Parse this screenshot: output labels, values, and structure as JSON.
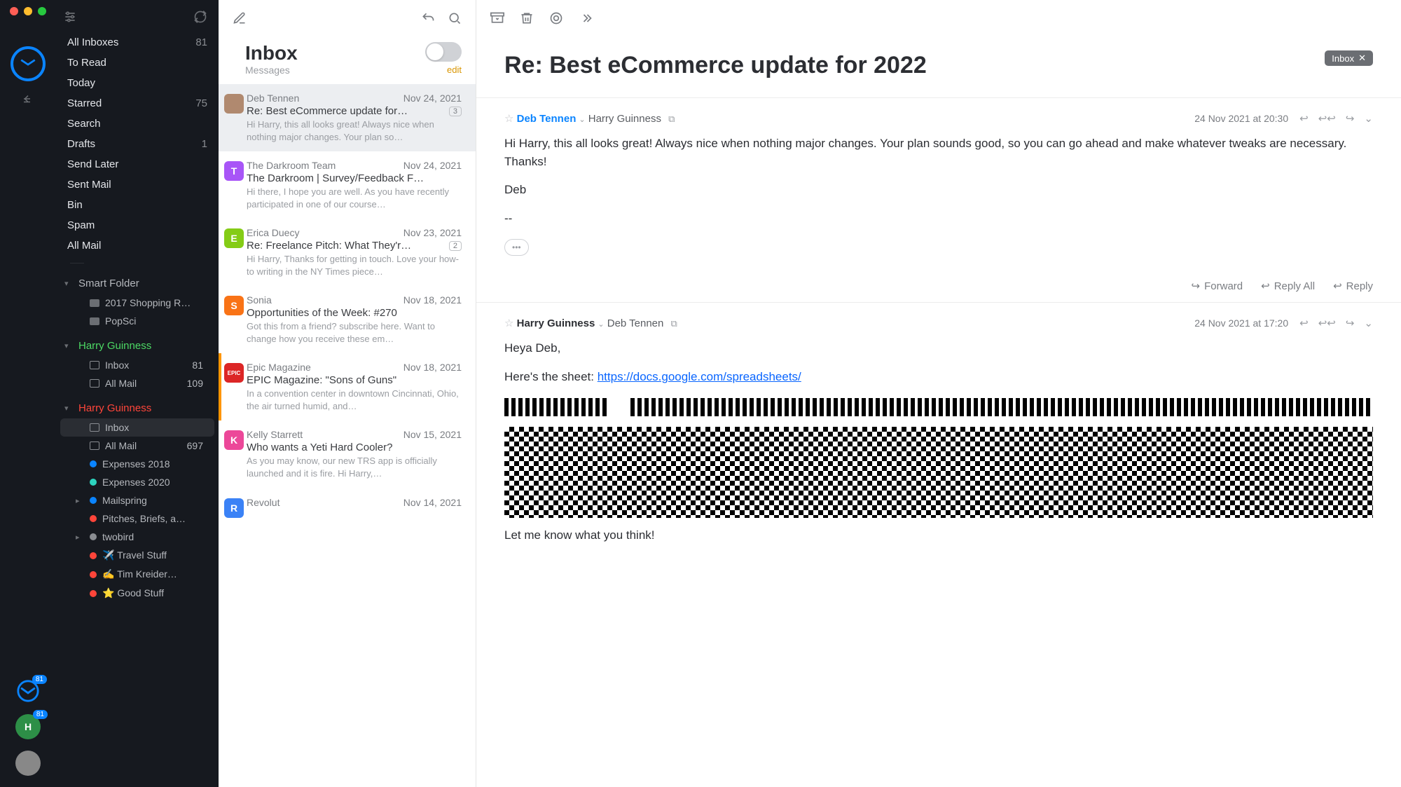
{
  "sidebar": {
    "nav": [
      {
        "label": "All Inboxes",
        "count": "81"
      },
      {
        "label": "To Read",
        "count": ""
      },
      {
        "label": "Today",
        "count": ""
      },
      {
        "label": "Starred",
        "count": "75"
      },
      {
        "label": "Search",
        "count": ""
      },
      {
        "label": "Drafts",
        "count": "1"
      },
      {
        "label": "Send Later",
        "count": ""
      },
      {
        "label": "Sent Mail",
        "count": ""
      },
      {
        "label": "Bin",
        "count": ""
      },
      {
        "label": "Spam",
        "count": ""
      },
      {
        "label": "All Mail",
        "count": ""
      }
    ],
    "smart_folder_label": "Smart Folder",
    "smart_folders": [
      {
        "label": "2017 Shopping R…"
      },
      {
        "label": "PopSci"
      }
    ],
    "accounts": [
      {
        "name": "Harry Guinness",
        "color": "green",
        "items": [
          {
            "label": "Inbox",
            "count": "81",
            "icon": "tray"
          },
          {
            "label": "All Mail",
            "count": "109",
            "icon": "tray"
          }
        ]
      },
      {
        "name": "Harry Guinness",
        "color": "red",
        "items": [
          {
            "label": "Inbox",
            "count": "",
            "icon": "tray",
            "selected": true
          },
          {
            "label": "All Mail",
            "count": "697",
            "icon": "tray"
          },
          {
            "label": "Expenses 2018",
            "count": "",
            "icon": "dot",
            "dot": "#0a84ff"
          },
          {
            "label": "Expenses 2020",
            "count": "",
            "icon": "dot",
            "dot": "#2dd4bf"
          },
          {
            "label": "Mailspring",
            "count": "",
            "icon": "dot",
            "dot": "#0a84ff",
            "expand": true
          },
          {
            "label": "Pitches, Briefs, a…",
            "count": "",
            "icon": "dot",
            "dot": "#ff453a"
          },
          {
            "label": "twobird",
            "count": "",
            "icon": "dot",
            "dot": "#8a8d92",
            "expand": true
          },
          {
            "label": "✈️ Travel Stuff",
            "count": "",
            "icon": "dot",
            "dot": "#ff453a"
          },
          {
            "label": "✍️ Tim Kreider…",
            "count": "",
            "icon": "dot",
            "dot": "#ff453a"
          },
          {
            "label": "⭐ Good Stuff",
            "count": "",
            "icon": "dot",
            "dot": "#ff453a"
          }
        ]
      }
    ],
    "icon_badges": {
      "mail": "81",
      "avatar": "81",
      "avatar_letter": "H"
    }
  },
  "list": {
    "title": "Inbox",
    "subtitle": "Messages",
    "edit": "edit",
    "messages": [
      {
        "avatar_bg": "#b0896f",
        "avatar_txt": "",
        "from": "Deb Tennen",
        "date": "Nov 24, 2021",
        "subject": "Re: Best eCommerce update for…",
        "thread": "3",
        "preview": "Hi Harry, this all looks great! Always nice when nothing major changes. Your plan so…",
        "selected": true
      },
      {
        "avatar_bg": "#a855f7",
        "avatar_txt": "T",
        "from": "The Darkroom Team",
        "date": "Nov 24, 2021",
        "subject": "The Darkroom | Survey/Feedback F…",
        "thread": "",
        "preview": "Hi there, I hope you are well. As you have recently participated in one of our course…"
      },
      {
        "avatar_bg": "#84cc16",
        "avatar_txt": "E",
        "from": "Erica Duecy",
        "date": "Nov 23, 2021",
        "subject": "Re: Freelance Pitch: What They'r…",
        "thread": "2",
        "preview": "Hi Harry, Thanks for getting in touch. Love your how-to writing in the NY Times piece…"
      },
      {
        "avatar_bg": "#f97316",
        "avatar_txt": "S",
        "from": "Sonia",
        "date": "Nov 18, 2021",
        "subject": "Opportunities of the Week: #270",
        "thread": "",
        "preview": "Got this from a friend? subscribe here. Want to change how you receive these em…"
      },
      {
        "avatar_bg": "#dc2626",
        "avatar_txt": "EPIC",
        "from": "Epic Magazine",
        "date": "Nov 18, 2021",
        "subject": "EPIC Magazine: \"Sons of Guns\"",
        "thread": "",
        "preview": "In a convention center in downtown Cincinnati, Ohio, the air turned humid, and…",
        "current": true
      },
      {
        "avatar_bg": "#ec4899",
        "avatar_txt": "K",
        "from": "Kelly Starrett",
        "date": "Nov 15, 2021",
        "subject": "Who wants a Yeti Hard Cooler?",
        "thread": "",
        "preview": "As you may know, our new TRS app is officially launched and it is fire. Hi Harry,…"
      },
      {
        "avatar_bg": "#3b82f6",
        "avatar_txt": "R",
        "from": "Revolut",
        "date": "Nov 14, 2021",
        "subject": "",
        "thread": "",
        "preview": ""
      }
    ]
  },
  "reader": {
    "title": "Re: Best eCommerce update for 2022",
    "tag": "Inbox",
    "emails": [
      {
        "from": "Deb Tennen",
        "to": "Harry Guinness",
        "date": "24 Nov 2021 at 20:30",
        "body": "Hi Harry, this all looks great! Always nice when nothing major changes. Your plan sounds good, so you can go ahead and make whatever tweaks are necessary. Thanks!",
        "sig": "Deb",
        "dashes": "--"
      },
      {
        "from": "Harry Guinness",
        "to": "Deb Tennen",
        "date": "24 Nov 2021 at 17:20",
        "body_intro": "Heya Deb,",
        "body_line": "Here's the sheet: ",
        "link": "https://docs.google.com/spreadsheets/",
        "closing": "Let me know what you think!"
      }
    ],
    "actions": {
      "forward": "Forward",
      "reply_all": "Reply All",
      "reply": "Reply"
    }
  }
}
